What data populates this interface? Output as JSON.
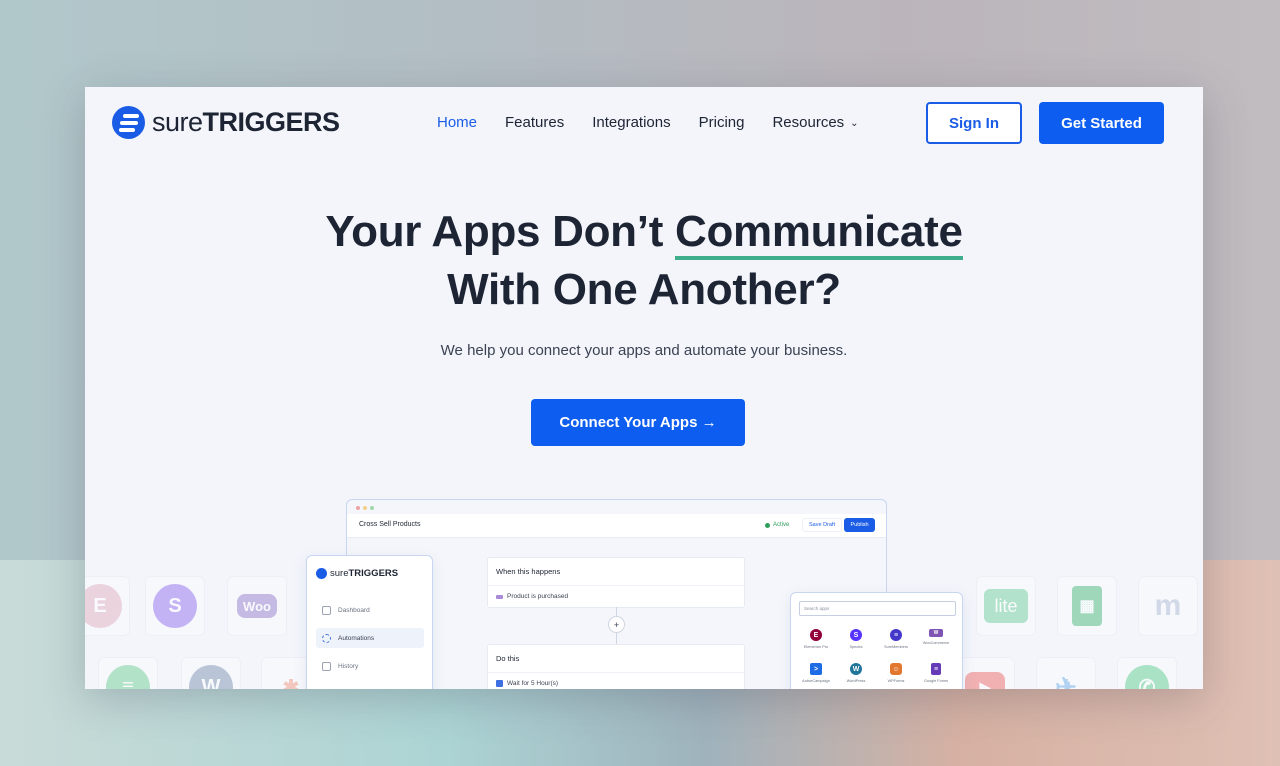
{
  "brand": {
    "name_light": "sure",
    "name_bold": "TRIGGERS",
    "accent_color": "#0d5ef0",
    "underline_color": "#3fae8b"
  },
  "nav": {
    "items": [
      {
        "label": "Home",
        "active": true
      },
      {
        "label": "Features",
        "active": false
      },
      {
        "label": "Integrations",
        "active": false
      },
      {
        "label": "Pricing",
        "active": false
      },
      {
        "label": "Resources",
        "active": false,
        "dropdown": true
      }
    ],
    "sign_in": "Sign In",
    "get_started": "Get Started"
  },
  "hero": {
    "title_part1": "Your Apps Don’t ",
    "title_highlight": "Communicate",
    "title_line2": "With One Another?",
    "subtitle": "We help you connect your apps and automate your business.",
    "cta": "Connect Your Apps →"
  },
  "mockup": {
    "workflow_title": "Cross Sell Products",
    "status": "Active",
    "save_draft": "Save Draft",
    "publish": "Publish",
    "trigger_header": "When this happens",
    "trigger_item": "Product is purchased",
    "action_header": "Do this",
    "action_item": "Wait for 5 Hour(s)",
    "sidebar": {
      "logo_light": "sure",
      "logo_bold": "TRIGGERS",
      "items": [
        {
          "label": "Dashboard",
          "icon": "grid-icon",
          "active": false
        },
        {
          "label": "Automations",
          "icon": "automation-icon",
          "active": true
        },
        {
          "label": "History",
          "icon": "archive-icon",
          "active": false
        }
      ]
    },
    "apps_panel": {
      "search_placeholder": "Search apps",
      "apps": [
        {
          "label": "Elementor Pro",
          "glyph": "E",
          "color": "#92003b"
        },
        {
          "label": "Spectra",
          "glyph": "S",
          "color": "#5733ff"
        },
        {
          "label": "SureMembers",
          "glyph": "≡",
          "color": "#4338ca"
        },
        {
          "label": "WooCommerce",
          "glyph": "W",
          "color": "#7f54b3"
        },
        {
          "label": "ActiveCampaign",
          "glyph": ">",
          "color": "#1e6be6"
        },
        {
          "label": "WordPress",
          "glyph": "W",
          "color": "#21759b"
        },
        {
          "label": "WPForms",
          "glyph": "☺",
          "color": "#e27730"
        },
        {
          "label": "Google Forms",
          "glyph": "≡",
          "color": "#673ab7"
        }
      ]
    }
  },
  "background_tiles": [
    {
      "name": "elementor",
      "glyph": "E",
      "color": "#e6b9c6"
    },
    {
      "name": "spectra",
      "glyph": "S",
      "color": "#9d7cf0"
    },
    {
      "name": "woocommerce",
      "glyph": "Woo",
      "color": "#a18bd1"
    },
    {
      "name": "suremembers",
      "glyph": "≡",
      "color": "#7dd3a0"
    },
    {
      "name": "wordpress",
      "glyph": "W",
      "color": "#8a9fb8"
    },
    {
      "name": "hubspot",
      "glyph": "✱",
      "color": "#f3a38d"
    },
    {
      "name": "lite",
      "glyph": "lite",
      "color": "#7ed3a4"
    },
    {
      "name": "google-sheets",
      "glyph": "▦",
      "color": "#5cbf85"
    },
    {
      "name": "memberpress",
      "glyph": "m",
      "color": "#b6c3da"
    },
    {
      "name": "youtube",
      "glyph": "▶",
      "color": "#f07a7a"
    },
    {
      "name": "twitter",
      "glyph": "✈",
      "color": "#7cb7ea"
    },
    {
      "name": "whatsapp",
      "glyph": "✆",
      "color": "#6fd49a"
    }
  ]
}
